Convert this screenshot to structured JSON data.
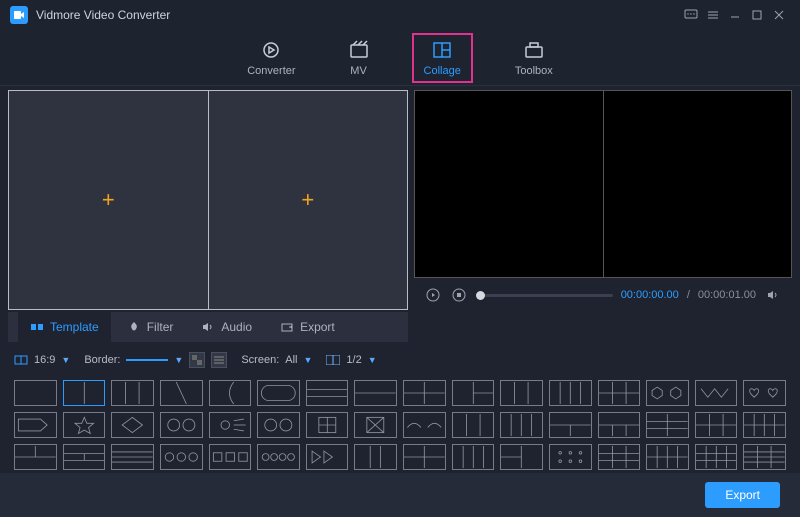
{
  "titlebar": {
    "title": "Vidmore Video Converter"
  },
  "nav": {
    "converter": "Converter",
    "mv": "MV",
    "collage": "Collage",
    "toolbox": "Toolbox"
  },
  "subtabs": {
    "template": "Template",
    "filter": "Filter",
    "audio": "Audio",
    "export": "Export"
  },
  "player": {
    "time_current": "00:00:00.00",
    "time_total": "00:00:01.00"
  },
  "controls": {
    "ratio": "16:9",
    "borderLabel": "Border:",
    "screenLabel": "Screen:",
    "screenValue": "All",
    "split": "1/2"
  },
  "footer": {
    "export": "Export"
  },
  "templates": [
    "blank",
    "v2",
    "v3",
    "diag",
    "curveL",
    "roundR",
    "h3",
    "h2eq",
    "g22a",
    "g22b",
    "v3eq",
    "v4",
    "g23a",
    "hexes",
    "zig",
    "hearts",
    "arrowtag",
    "star",
    "diamond",
    "circ2",
    "sunburst",
    "circ2b",
    "plusgrid",
    "xgrid",
    "wave3",
    "v3b",
    "v4b",
    "g23b",
    "g23c",
    "g32",
    "g33",
    "g24",
    "g13",
    "g31",
    "h4",
    "circ3",
    "rect3",
    "circ4",
    "fwd2",
    "v3c",
    "g22c",
    "v4c",
    "g22d",
    "gdots",
    "g33b",
    "g43",
    "g43b",
    "g34"
  ]
}
